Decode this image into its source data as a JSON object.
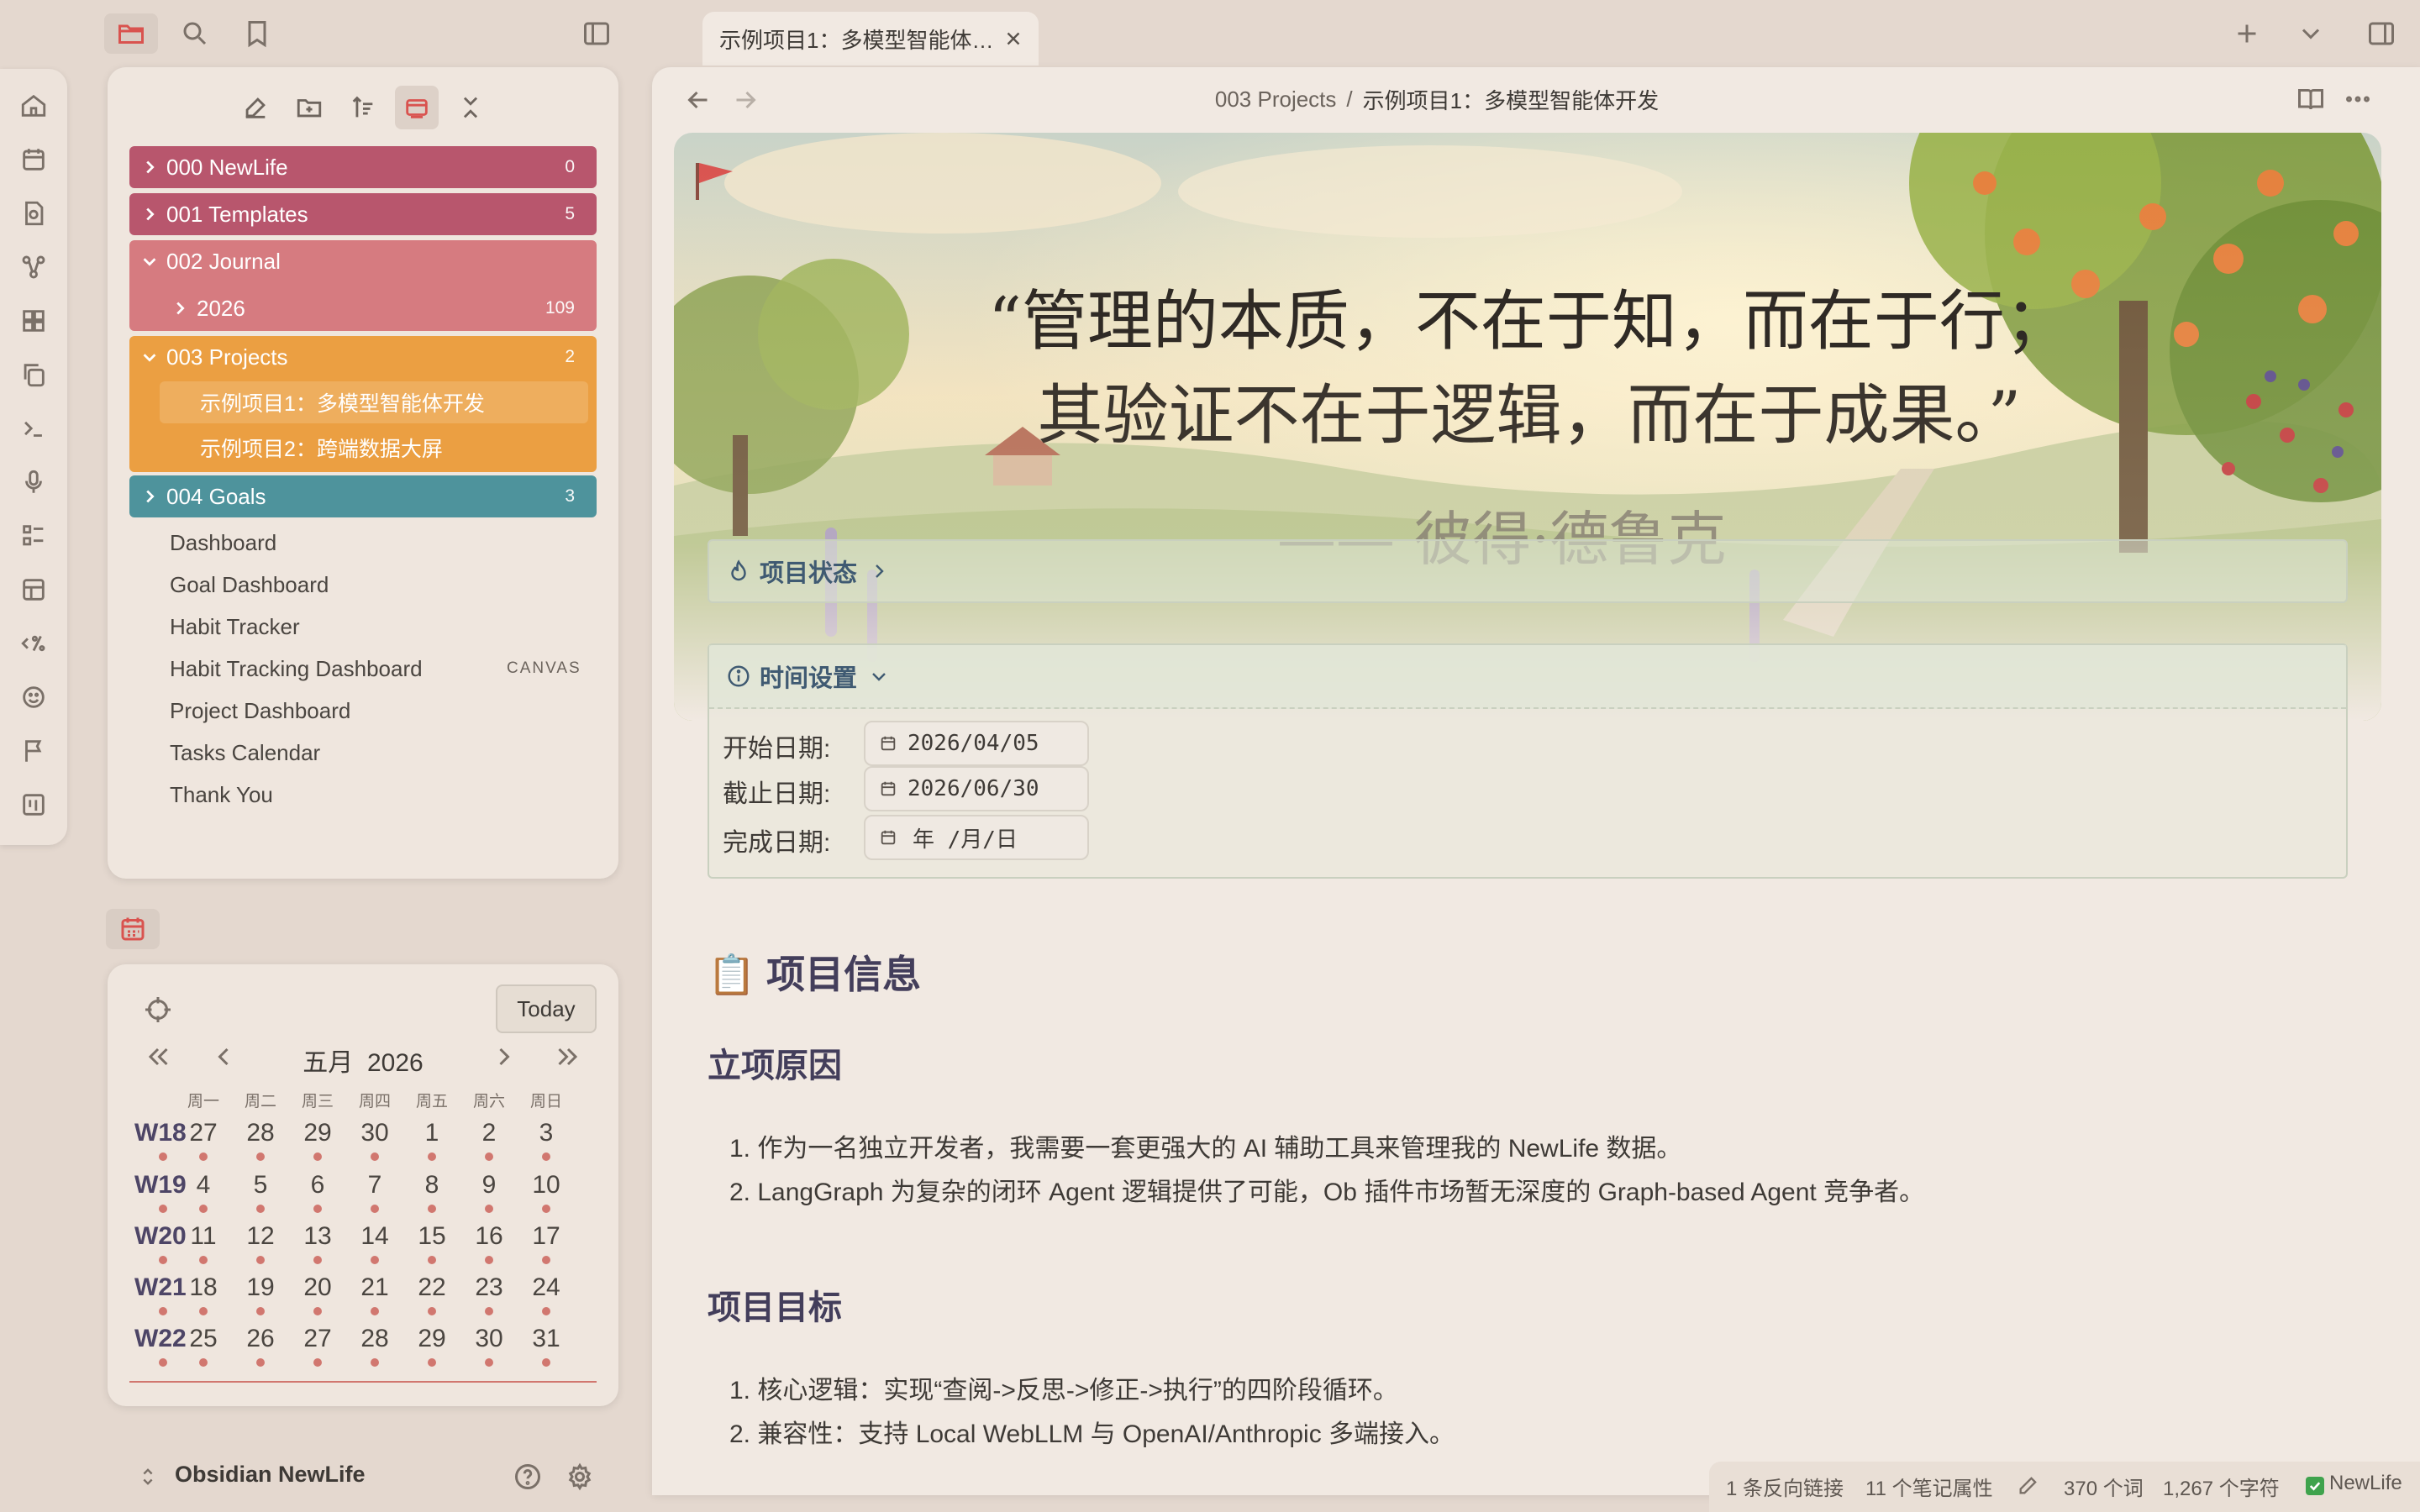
{
  "tab": {
    "title": "示例项目1：多模型智能体…"
  },
  "breadcrumb": {
    "folder": "003 Projects",
    "separator": "/",
    "file": "示例项目1：多模型智能体开发"
  },
  "explorer": {
    "folders": [
      {
        "label": "000 NewLife",
        "count": "0",
        "color": "#b8566d"
      },
      {
        "label": "001 Templates",
        "count": "5",
        "color": "#b8566d"
      },
      {
        "label": "002 Journal",
        "count": "",
        "color": "#d67b80"
      },
      {
        "label": "2026",
        "count": "109",
        "color": "#d67b80"
      },
      {
        "label": "003 Projects",
        "count": "2",
        "color": "#eb9f42"
      },
      {
        "label": "示例项目1：多模型智能体开发",
        "count": "",
        "color": "#eba552"
      },
      {
        "label": "示例项目2：跨端数据大屏",
        "count": "",
        "color": "#eb9f42"
      },
      {
        "label": "004 Goals",
        "count": "3",
        "color": "#4e939c"
      }
    ],
    "files": [
      "Dashboard",
      "Goal Dashboard",
      "Habit Tracker",
      "Habit Tracking Dashboard",
      "Project Dashboard",
      "Tasks Calendar",
      "Thank You"
    ],
    "file_tag": "CANVAS"
  },
  "calendar": {
    "today_label": "Today",
    "month_label": "五月  2026",
    "weekdays": [
      "周一",
      "周二",
      "周三",
      "周四",
      "周五",
      "周六",
      "周日"
    ],
    "weeks": [
      {
        "label": "W18",
        "days": [
          "27",
          "28",
          "29",
          "30",
          "1",
          "2",
          "3"
        ]
      },
      {
        "label": "W19",
        "days": [
          "4",
          "5",
          "6",
          "7",
          "8",
          "9",
          "10"
        ]
      },
      {
        "label": "W20",
        "days": [
          "11",
          "12",
          "13",
          "14",
          "15",
          "16",
          "17"
        ]
      },
      {
        "label": "W21",
        "days": [
          "18",
          "19",
          "20",
          "21",
          "22",
          "23",
          "24"
        ]
      },
      {
        "label": "W22",
        "days": [
          "25",
          "26",
          "27",
          "28",
          "29",
          "30",
          "31"
        ]
      }
    ]
  },
  "vault": {
    "name": "Obsidian NewLife"
  },
  "hero": {
    "quote_line1": "“管理的本质，不在于知，而在于行；",
    "quote_line2": "其验证不在于逻辑，而在于成果。”",
    "author": "—— 彼得·德鲁克"
  },
  "callouts": {
    "status_title": "项目状态",
    "time_title": "时间设置"
  },
  "dates": {
    "start_label": "开始日期:",
    "start_value": "2026/04/05",
    "end_label": "截止日期:",
    "end_value": "2026/06/30",
    "done_label": "完成日期:",
    "done_value": "年 /月/日"
  },
  "content": {
    "h1": "项目信息",
    "h1_icon": "📋",
    "reason_heading": "立项原因",
    "reasons": [
      "1. 作为一名独立开发者，我需要一套更强大的 AI 辅助工具来管理我的 NewLife 数据。",
      "2. LangGraph 为复杂的闭环 Agent 逻辑提供了可能，Ob 插件市场暂无深度的 Graph-based Agent 竞争者。"
    ],
    "goal_heading": "项目目标",
    "goals": [
      "1. 核心逻辑：实现“查阅->反思->修正->执行”的四阶段循环。",
      "2. 兼容性：支持 Local WebLLM 与 OpenAI/Anthropic 多端接入。"
    ]
  },
  "statusbar": {
    "backlinks": "1 条反向链接",
    "properties": "11 个笔记属性",
    "words": "370 个词",
    "chars": "1,267 个字符",
    "vault": "NewLife"
  },
  "colors": {
    "background": "#e4d8cf",
    "panel": "#efe6de",
    "heading": "#433e5b",
    "accent_red": "#d1776f"
  }
}
